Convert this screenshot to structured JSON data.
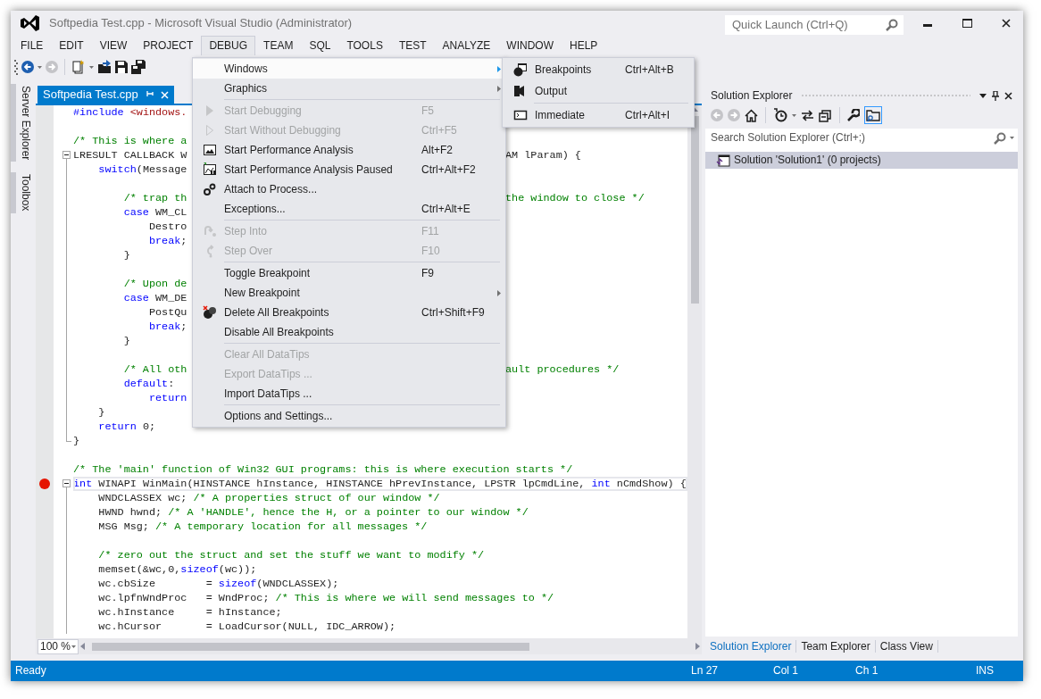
{
  "window": {
    "title": "Softpedia Test.cpp - Microsoft Visual Studio (Administrator)"
  },
  "quick_launch": {
    "placeholder": "Quick Launch (Ctrl+Q)"
  },
  "menu_bar": [
    {
      "label": "FILE",
      "selected": false
    },
    {
      "label": "EDIT",
      "selected": false
    },
    {
      "label": "VIEW",
      "selected": false
    },
    {
      "label": "PROJECT",
      "selected": false
    },
    {
      "label": "DEBUG",
      "selected": true
    },
    {
      "label": "TEAM",
      "selected": false
    },
    {
      "label": "SQL",
      "selected": false
    },
    {
      "label": "TOOLS",
      "selected": false
    },
    {
      "label": "TEST",
      "selected": false
    },
    {
      "label": "ANALYZE",
      "selected": false
    },
    {
      "label": "WINDOW",
      "selected": false
    },
    {
      "label": "HELP",
      "selected": false
    }
  ],
  "side_tabs": [
    "Server Explorer",
    "Toolbox"
  ],
  "editor": {
    "tabs": [
      {
        "label": "Softpedia Test.cpp",
        "selected": true
      }
    ],
    "lines": [
      {
        "breakpoint": false,
        "selected": false,
        "tokens": [
          {
            "kind": "preprocessor",
            "text": "#include"
          },
          {
            "kind": "string",
            "text": " <windows."
          }
        ]
      },
      {
        "breakpoint": false,
        "selected": false
      },
      {
        "breakpoint": false,
        "selected": false,
        "tokens": [
          {
            "kind": "comment",
            "text": "/* This is where a"
          }
        ]
      },
      {
        "breakpoint": false,
        "selected": false,
        "expanded": true,
        "tokens": [
          {
            "kind": "plain",
            "text": "LRESULT CALLBACK W"
          }
        ],
        "tail": [
          {
            "kind": "plain",
            "text": "AM lParam) {"
          }
        ],
        "children": [
          {
            "breakpoint": false,
            "selected": false,
            "tokens": [
              {
                "kind": "keyword",
                "text": "    switch"
              },
              {
                "kind": "plain",
                "text": "(Message"
              }
            ]
          },
          {
            "breakpoint": false,
            "selected": false
          },
          {
            "breakpoint": false,
            "selected": false,
            "tokens": [
              {
                "kind": "comment",
                "text": "        /* trap th"
              }
            ],
            "tail": [
              {
                "kind": "comment",
                "text": "the window to close */"
              }
            ]
          },
          {
            "breakpoint": false,
            "selected": false,
            "tokens": [
              {
                "kind": "keyword",
                "text": "        case"
              },
              {
                "kind": "plain",
                "text": " WM_CL"
              }
            ]
          },
          {
            "breakpoint": false,
            "selected": false,
            "tokens": [
              {
                "kind": "plain",
                "text": "            Destro"
              }
            ]
          },
          {
            "breakpoint": false,
            "selected": false,
            "tokens": [
              {
                "kind": "keyword",
                "text": "            break"
              },
              {
                "kind": "plain",
                "text": ";"
              }
            ]
          },
          {
            "breakpoint": false,
            "selected": false,
            "tokens": [
              {
                "kind": "plain",
                "text": "        }"
              }
            ]
          },
          {
            "breakpoint": false,
            "selected": false
          },
          {
            "breakpoint": false,
            "selected": false,
            "tokens": [
              {
                "kind": "comment",
                "text": "        /* Upon de"
              }
            ]
          },
          {
            "breakpoint": false,
            "selected": false,
            "tokens": [
              {
                "kind": "keyword",
                "text": "        case"
              },
              {
                "kind": "plain",
                "text": " WM_DE"
              }
            ]
          },
          {
            "breakpoint": false,
            "selected": false,
            "tokens": [
              {
                "kind": "plain",
                "text": "            PostQu"
              }
            ]
          },
          {
            "breakpoint": false,
            "selected": false,
            "tokens": [
              {
                "kind": "keyword",
                "text": "            break"
              },
              {
                "kind": "plain",
                "text": ";"
              }
            ]
          },
          {
            "breakpoint": false,
            "selected": false,
            "tokens": [
              {
                "kind": "plain",
                "text": "        }"
              }
            ]
          },
          {
            "breakpoint": false,
            "selected": false
          },
          {
            "breakpoint": false,
            "selected": false,
            "tokens": [
              {
                "kind": "comment",
                "text": "        /* All oth"
              }
            ],
            "tail": [
              {
                "kind": "comment",
                "text": "ault procedures */"
              }
            ]
          },
          {
            "breakpoint": false,
            "selected": false,
            "tokens": [
              {
                "kind": "keyword",
                "text": "        default"
              },
              {
                "kind": "plain",
                "text": ":"
              }
            ]
          },
          {
            "breakpoint": false,
            "selected": false,
            "tokens": [
              {
                "kind": "keyword",
                "text": "            return"
              }
            ]
          },
          {
            "breakpoint": false,
            "selected": false,
            "tokens": [
              {
                "kind": "plain",
                "text": "    }"
              }
            ]
          },
          {
            "breakpoint": false,
            "selected": false,
            "tokens": [
              {
                "kind": "keyword",
                "text": "    return"
              },
              {
                "kind": "plain",
                "text": " 0;"
              }
            ]
          },
          {
            "breakpoint": false,
            "selected": false,
            "tokens": [
              {
                "kind": "plain",
                "text": "}"
              }
            ]
          }
        ]
      },
      {
        "breakpoint": false,
        "selected": false
      },
      {
        "breakpoint": false,
        "selected": false,
        "tokens": [
          {
            "kind": "comment",
            "text": "/* The 'main' function of Win32 GUI programs: this is where execution starts */"
          }
        ]
      },
      {
        "breakpoint": true,
        "selected": true,
        "expanded": true,
        "tokens": [
          {
            "kind": "keyword",
            "text": "int"
          },
          {
            "kind": "plain",
            "text": " WINAPI WinMain(HINSTANCE hInstance, HINSTANCE hPrevInstance, LPSTR lpCmdLine, "
          },
          {
            "kind": "keyword",
            "text": "int"
          },
          {
            "kind": "plain",
            "text": " nCmdShow) {"
          }
        ],
        "children": [
          {
            "breakpoint": false,
            "selected": false,
            "tokens": [
              {
                "kind": "plain",
                "text": "    WNDCLASSEX wc; "
              },
              {
                "kind": "comment",
                "text": "/* A properties struct of our window */"
              }
            ]
          },
          {
            "breakpoint": false,
            "selected": false,
            "tokens": [
              {
                "kind": "plain",
                "text": "    HWND hwnd; "
              },
              {
                "kind": "comment",
                "text": "/* A 'HANDLE', hence the H, or a pointer to our window */"
              }
            ]
          },
          {
            "breakpoint": false,
            "selected": false,
            "tokens": [
              {
                "kind": "plain",
                "text": "    MSG Msg; "
              },
              {
                "kind": "comment",
                "text": "/* A temporary location for all messages */"
              }
            ]
          },
          {
            "breakpoint": false,
            "selected": false
          },
          {
            "breakpoint": false,
            "selected": false,
            "tokens": [
              {
                "kind": "comment",
                "text": "    /* zero out the struct and set the stuff we want to modify */"
              }
            ]
          },
          {
            "breakpoint": false,
            "selected": false,
            "tokens": [
              {
                "kind": "plain",
                "text": "    memset(&wc,0,"
              },
              {
                "kind": "keyword",
                "text": "sizeof"
              },
              {
                "kind": "plain",
                "text": "(wc));"
              }
            ]
          },
          {
            "breakpoint": false,
            "selected": false,
            "tokens": [
              {
                "kind": "plain",
                "text": "    wc.cbSize        = "
              },
              {
                "kind": "keyword",
                "text": "sizeof"
              },
              {
                "kind": "plain",
                "text": "(WNDCLASSEX);"
              }
            ]
          },
          {
            "breakpoint": false,
            "selected": false,
            "tokens": [
              {
                "kind": "plain",
                "text": "    wc.lpfnWndProc   = WndProc; "
              },
              {
                "kind": "comment",
                "text": "/* This is where we will send messages to */"
              }
            ]
          },
          {
            "breakpoint": false,
            "selected": false,
            "tokens": [
              {
                "kind": "plain",
                "text": "    wc.hInstance     = hInstance;"
              }
            ]
          },
          {
            "breakpoint": false,
            "selected": false,
            "tokens": [
              {
                "kind": "plain",
                "text": "    wc.hCursor       = LoadCursor(NULL, IDC_ARROW);"
              }
            ]
          }
        ]
      }
    ],
    "zoom": "100 %"
  },
  "debug_menu": {
    "items": [
      {
        "kind": "item",
        "label": "Windows",
        "disabled": false,
        "selected": true,
        "submenu": true
      },
      {
        "kind": "item",
        "label": "Graphics",
        "disabled": false,
        "selected": false,
        "submenu": true
      },
      {
        "kind": "separator"
      },
      {
        "kind": "item",
        "label": "Start Debugging",
        "shortcut": "F5",
        "disabled": true,
        "selected": false,
        "submenu": false
      },
      {
        "kind": "item",
        "label": "Start Without Debugging",
        "shortcut": "Ctrl+F5",
        "disabled": true,
        "selected": false,
        "submenu": false
      },
      {
        "kind": "item",
        "label": "Start Performance Analysis",
        "shortcut": "Alt+F2",
        "disabled": false,
        "selected": false,
        "submenu": false
      },
      {
        "kind": "item",
        "label": "Start Performance Analysis Paused",
        "shortcut": "Ctrl+Alt+F2",
        "disabled": false,
        "selected": false,
        "submenu": false
      },
      {
        "kind": "item",
        "label": "Attach to Process...",
        "disabled": false,
        "selected": false,
        "submenu": false
      },
      {
        "kind": "item",
        "label": "Exceptions...",
        "shortcut": "Ctrl+Alt+E",
        "disabled": false,
        "selected": false,
        "submenu": false
      },
      {
        "kind": "separator"
      },
      {
        "kind": "item",
        "label": "Step Into",
        "shortcut": "F11",
        "disabled": true,
        "selected": false,
        "submenu": false
      },
      {
        "kind": "item",
        "label": "Step Over",
        "shortcut": "F10",
        "disabled": true,
        "selected": false,
        "submenu": false
      },
      {
        "kind": "separator"
      },
      {
        "kind": "item",
        "label": "Toggle Breakpoint",
        "shortcut": "F9",
        "disabled": false,
        "selected": false,
        "submenu": false
      },
      {
        "kind": "item",
        "label": "New Breakpoint",
        "disabled": false,
        "selected": false,
        "submenu": true
      },
      {
        "kind": "item",
        "label": "Delete All Breakpoints",
        "shortcut": "Ctrl+Shift+F9",
        "disabled": false,
        "selected": false,
        "submenu": false
      },
      {
        "kind": "item",
        "label": "Disable All Breakpoints",
        "disabled": false,
        "selected": false,
        "submenu": false
      },
      {
        "kind": "separator"
      },
      {
        "kind": "item",
        "label": "Clear All DataTips",
        "disabled": true,
        "selected": false,
        "submenu": false
      },
      {
        "kind": "item",
        "label": "Export DataTips ...",
        "disabled": true,
        "selected": false,
        "submenu": false
      },
      {
        "kind": "item",
        "label": "Import DataTips ...",
        "disabled": false,
        "selected": false,
        "submenu": false
      },
      {
        "kind": "separator"
      },
      {
        "kind": "item",
        "label": "Options and Settings...",
        "disabled": false,
        "selected": false,
        "submenu": false
      }
    ]
  },
  "windows_submenu": {
    "items": [
      {
        "kind": "item",
        "label": "Breakpoints",
        "shortcut": "Ctrl+Alt+B"
      },
      {
        "kind": "item",
        "label": "Output"
      },
      {
        "kind": "separator"
      },
      {
        "kind": "item",
        "label": "Immediate",
        "shortcut": "Ctrl+Alt+I"
      }
    ]
  },
  "solution_explorer": {
    "title": "Solution Explorer",
    "search": {
      "placeholder": "Search Solution Explorer (Ctrl+;)"
    },
    "tree": [
      {
        "label": "Solution 'Solution1' (0 projects)",
        "selected": true
      }
    ],
    "tabs": [
      {
        "label": "Solution Explorer",
        "selected": true
      },
      {
        "label": "Team Explorer",
        "selected": false
      },
      {
        "label": "Class View",
        "selected": false
      }
    ]
  },
  "status_bar": {
    "message": "Ready",
    "line": "Ln 27",
    "column": "Col 1",
    "char": "Ch 1",
    "mode": "INS"
  }
}
